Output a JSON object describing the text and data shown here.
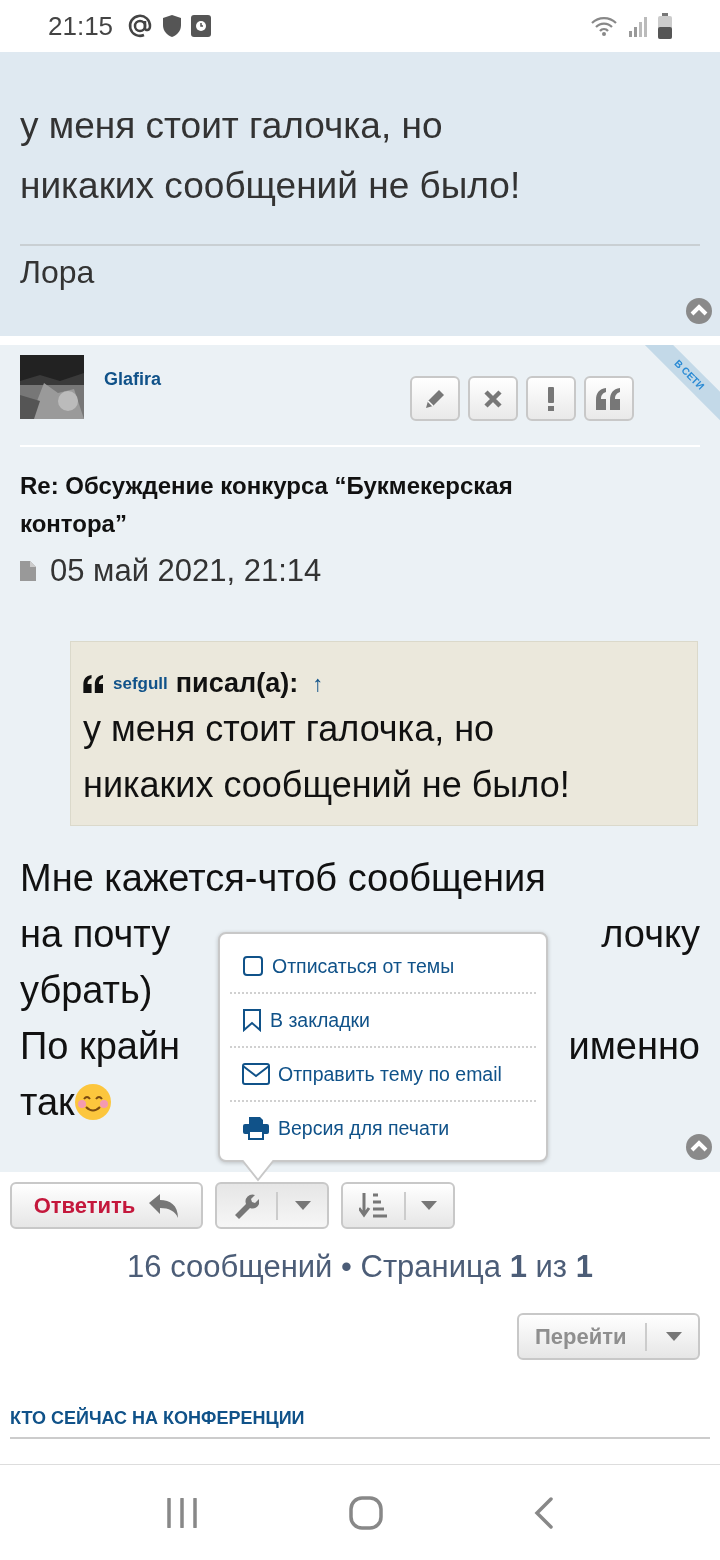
{
  "status_bar": {
    "time": "21:15"
  },
  "previous_post": {
    "body": "у меня стоит галочка, но\nникаких сообщений не было!",
    "signature": "Лора"
  },
  "post": {
    "author": "Glafira",
    "online_badge": "В СЕТИ",
    "actions": [
      {
        "kind": "edit"
      },
      {
        "kind": "delete"
      },
      {
        "kind": "report"
      },
      {
        "kind": "quote"
      }
    ],
    "title": "Re: Обсуждение конкурса “Букмекерская\nконтора”",
    "date": "05 май 2021, 21:14",
    "quote": {
      "author": "sefgull",
      "wrote": "писал(а):",
      "jump": "↑",
      "body": "у меня стоит галочка, но\nникаких сообщений не было!"
    },
    "body_lines": [
      {
        "left": "Мне кажется-чтоб сообщения",
        "emoji": false
      },
      {
        "left": "на почту",
        "right": "лочку",
        "emoji": false
      },
      {
        "left": "убрать)",
        "emoji": false
      },
      {
        "left": "По крайн",
        "right": "именно",
        "emoji": false
      },
      {
        "left": "так",
        "emoji": true
      }
    ]
  },
  "toolbar": {
    "reply": "Ответить",
    "tools_open": true,
    "sort_open": false
  },
  "tools_menu": [
    {
      "kind": "unsubscribe",
      "label": "Отписаться от темы"
    },
    {
      "kind": "bookmark",
      "label": "В закладки"
    },
    {
      "kind": "email",
      "label": "Отправить тему по email"
    },
    {
      "kind": "print",
      "label": "Версия для печати"
    }
  ],
  "pagination": "16 сообщений • Страница **1** из **1**",
  "jump_button": "Перейти",
  "section_heading": "КТО СЕЙЧАС НА КОНФЕРЕНЦИИ"
}
